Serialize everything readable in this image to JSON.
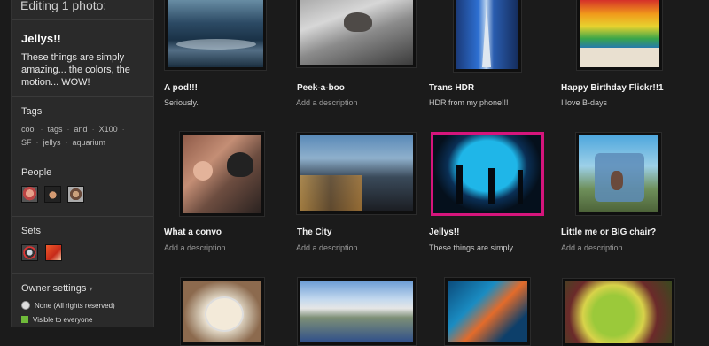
{
  "sidebar": {
    "heading": "Editing 1 photo:",
    "photo_title": "Jellys!!",
    "photo_description": "These things are simply amazing... the colors, the motion... WOW!",
    "tags_heading": "Tags",
    "tags": [
      "cool",
      "tags",
      "and",
      "X100",
      "SF",
      "jellys",
      "aquarium"
    ],
    "people_heading": "People",
    "people": [
      "person-1",
      "person-2",
      "person-3"
    ],
    "sets_heading": "Sets",
    "sets": [
      "set-1",
      "set-2"
    ],
    "owner_heading": "Owner settings",
    "owner_license": "None (All rights reserved)",
    "owner_visibility": "Visible to everyone"
  },
  "photos": [
    {
      "title": "A pod!!!",
      "description": "Seriously."
    },
    {
      "title": "Peek-a-boo",
      "description": "Add a description"
    },
    {
      "title": "Trans HDR",
      "description": "HDR from my phone!!!"
    },
    {
      "title": "Happy Birthday Flickr!!1",
      "description": "I love B-days"
    },
    {
      "title": "What a convo",
      "description": "Add a description"
    },
    {
      "title": "The City",
      "description": "Add a description"
    },
    {
      "title": "Jellys!!",
      "description": "These things are simply"
    },
    {
      "title": "Little me or BIG chair?",
      "description": "Add a description"
    }
  ]
}
